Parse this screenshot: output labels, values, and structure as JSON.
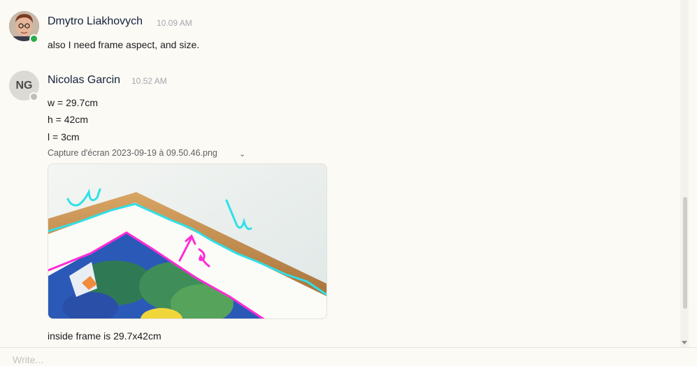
{
  "messages": [
    {
      "author": "Dmytro Liakhovych",
      "time": "10.09 AM",
      "lines": [
        "also I need frame aspect, and size."
      ]
    },
    {
      "author": "Nicolas Garcin",
      "initials": "NG",
      "time": "10.52 AM",
      "lines": [
        "w = 29.7cm",
        "h = 42cm",
        "l = 3cm"
      ],
      "attachment": {
        "file_name": "Capture d'écran 2023-09-19 à 09.50.46.png"
      },
      "after_text": "inside frame is 29.7x42cm"
    }
  ],
  "composer": {
    "placeholder": "Write..."
  },
  "colors": {
    "online": "#2bac47",
    "away": "#bdbdbd",
    "annotation_cyan": "#2fe0e8",
    "annotation_magenta": "#ff2bd6"
  }
}
